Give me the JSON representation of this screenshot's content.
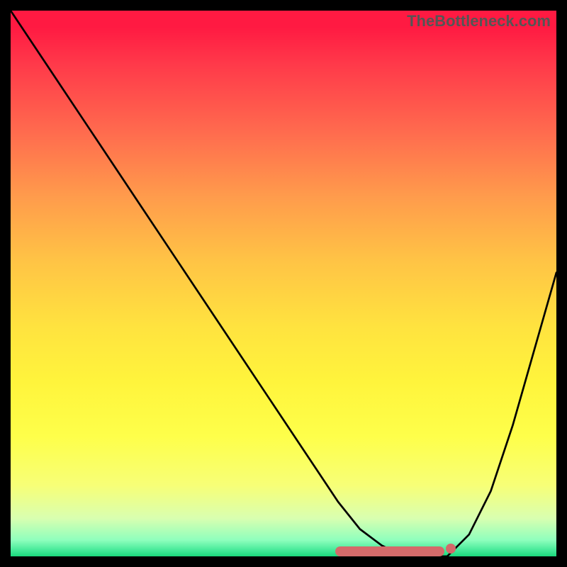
{
  "watermark": "TheBottleneck.com",
  "chart_data": {
    "type": "line",
    "title": "",
    "xlabel": "",
    "ylabel": "",
    "xlim": [
      0,
      100
    ],
    "ylim": [
      0,
      100
    ],
    "grid": false,
    "legend": false,
    "series": [
      {
        "name": "bottleneck-curve",
        "x": [
          0,
          8,
          16,
          24,
          32,
          40,
          48,
          56,
          60,
          64,
          68,
          72,
          76,
          80,
          84,
          88,
          92,
          96,
          100
        ],
        "values": [
          100,
          88,
          76,
          64,
          52,
          40,
          28,
          16,
          10,
          5,
          2,
          0,
          0,
          0,
          4,
          12,
          24,
          38,
          52
        ]
      }
    ],
    "highlight": {
      "x_start": 60,
      "x_end": 80,
      "y": 0,
      "color": "#d46a6a",
      "note": "minimum plateau"
    },
    "background_gradient": {
      "top": "#ff1a42",
      "mid": "#ffe33f",
      "bottom": "#1ad97c"
    }
  }
}
